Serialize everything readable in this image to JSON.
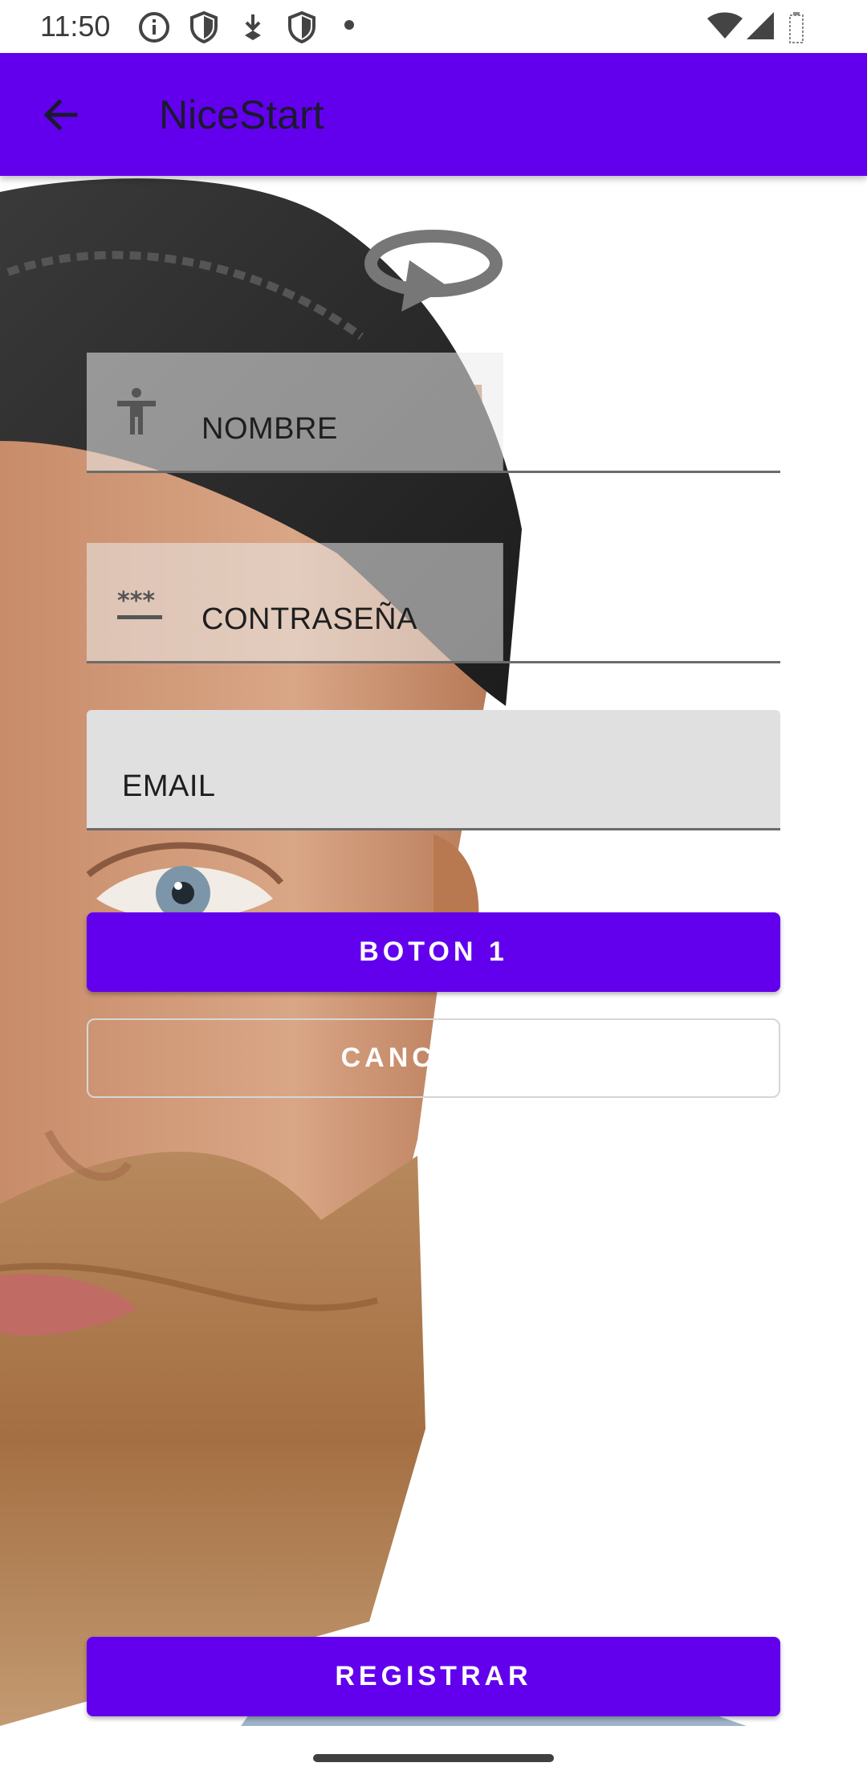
{
  "status_bar": {
    "time": "11:50",
    "left_icons": [
      "info-icon",
      "shield-icon",
      "download-icon",
      "shield-icon",
      "dot-icon"
    ],
    "right_icons": [
      "wifi-icon",
      "signal-icon",
      "battery-icon"
    ]
  },
  "app_bar": {
    "title": "NiceStart",
    "back_icon": "arrow-back-icon",
    "background": "#6200ee"
  },
  "header_icon": "reload-icon",
  "form": {
    "name_field": {
      "icon": "accessibility-icon",
      "hint": "NOMBRE"
    },
    "password_field": {
      "icon": "password-icon",
      "hint": "CONTRASEÑA"
    },
    "email_field": {
      "hint": "EMAIL"
    }
  },
  "buttons": {
    "primary": "BOTON 1",
    "secondary": "CANCELAR",
    "register": "REGISTRAR"
  },
  "colors": {
    "accent": "#6200ee",
    "field_fill": "#e0e0e0"
  }
}
